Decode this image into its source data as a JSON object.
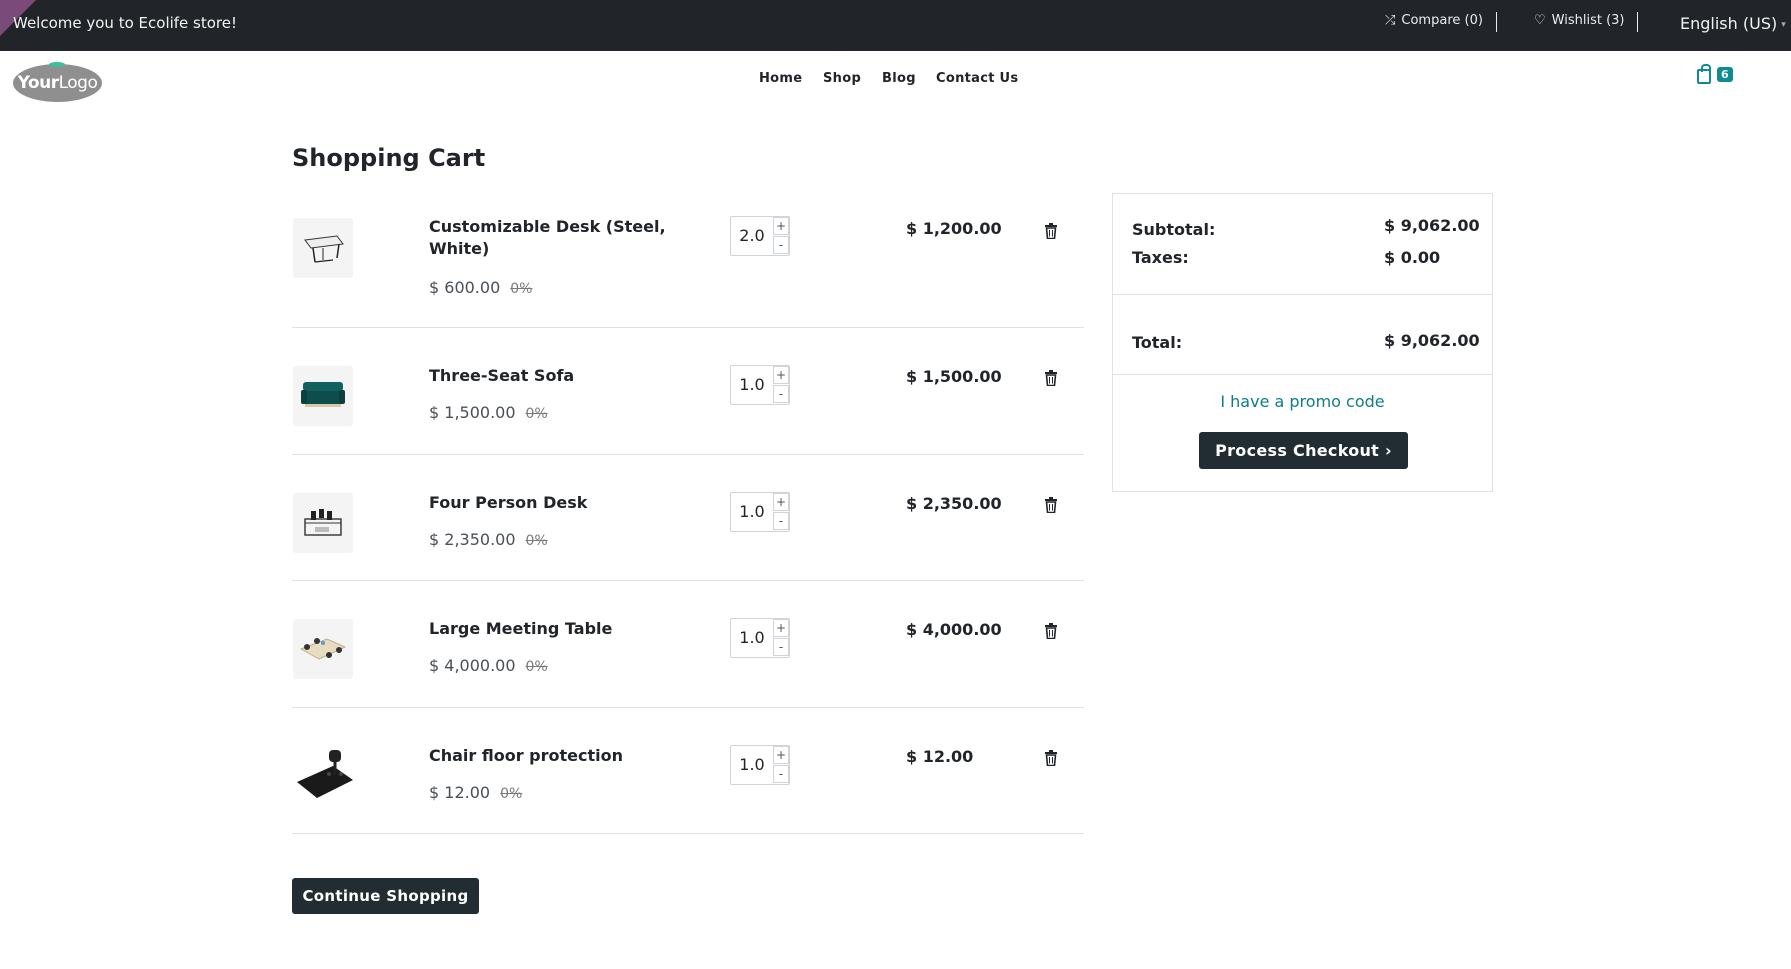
{
  "topbar": {
    "welcome": "Welcome you to Ecolife store!",
    "compare_label": "Compare (0)",
    "wishlist_label": "Wishlist (3)",
    "language": "English (US)"
  },
  "header": {
    "logo_part1": "Your",
    "logo_part2": "Logo",
    "nav": [
      "Home",
      "Shop",
      "Blog",
      "Contact Us"
    ],
    "cart_count": "6"
  },
  "cart": {
    "title": "Shopping Cart",
    "items": [
      {
        "name": "Customizable Desk (Steel, White)",
        "unit_price": "$ 600.00",
        "discount": "0%",
        "qty": "2.0",
        "line_total": "$ 1,200.00",
        "plus": "+",
        "minus": "-"
      },
      {
        "name": "Three-Seat Sofa",
        "unit_price": "$ 1,500.00",
        "discount": "0%",
        "qty": "1.0",
        "line_total": "$ 1,500.00",
        "plus": "+",
        "minus": "-"
      },
      {
        "name": "Four Person Desk",
        "unit_price": "$ 2,350.00",
        "discount": "0%",
        "qty": "1.0",
        "line_total": "$ 2,350.00",
        "plus": "+",
        "minus": "-"
      },
      {
        "name": "Large Meeting Table",
        "unit_price": "$ 4,000.00",
        "discount": "0%",
        "qty": "1.0",
        "line_total": "$ 4,000.00",
        "plus": "+",
        "minus": "-"
      },
      {
        "name": "Chair floor protection",
        "unit_price": "$ 12.00",
        "discount": "0%",
        "qty": "1.0",
        "line_total": "$ 12.00",
        "plus": "+",
        "minus": "-"
      }
    ],
    "continue_label": "Continue Shopping"
  },
  "summary": {
    "subtotal_label": "Subtotal:",
    "subtotal": "$ 9,062.00",
    "taxes_label": "Taxes:",
    "taxes": "$ 0.00",
    "total_label": "Total:",
    "total": "$ 9,062.00",
    "promo_label": "I have a promo code",
    "checkout_label": "Process Checkout"
  },
  "colors": {
    "accent": "#0e8b93",
    "dark": "#212529",
    "button": "#222c33"
  }
}
